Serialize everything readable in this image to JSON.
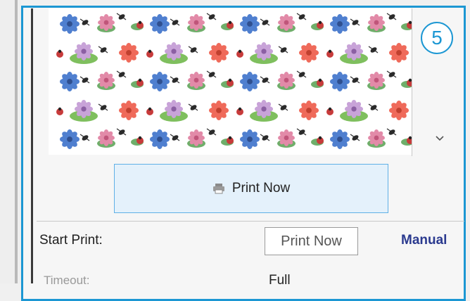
{
  "callout": {
    "number": "5",
    "color": "#1c97d3"
  },
  "actions": {
    "print_now_label": "Print Now",
    "accent": "#5fb0e6"
  },
  "tooltip": {
    "text": "Print Now"
  },
  "settings": {
    "start_print_label": "Start Print:",
    "start_print_value": "Manual",
    "timeout_label": "Timeout:",
    "timeout_value": "Full"
  },
  "preview": {
    "pattern": "floral"
  },
  "icons": {
    "print": "printer-icon",
    "scroll": "chevron-down-icon"
  }
}
